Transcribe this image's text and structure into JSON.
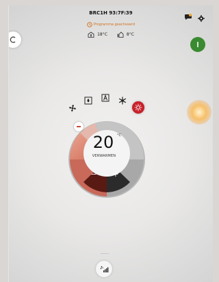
{
  "header": {
    "device_name": "BRC1H 93:7F:39",
    "program_text": "Programma geactiveerd",
    "program_color": "#d0711f"
  },
  "temperatures": {
    "indoor": "18°C",
    "outdoor": "8°C"
  },
  "thermostat": {
    "setpoint": "20",
    "unit": "°C",
    "mode_label": "VERWARMEN",
    "minus_label": "−",
    "plus_label": "+",
    "modes": [
      "fan-icon",
      "dry-icon",
      "auto-icon",
      "cool-icon",
      "heat-icon"
    ],
    "active_mode": "heat",
    "heat_color": "#c8202a"
  },
  "controls": {
    "power_color": "#3a8a32"
  }
}
